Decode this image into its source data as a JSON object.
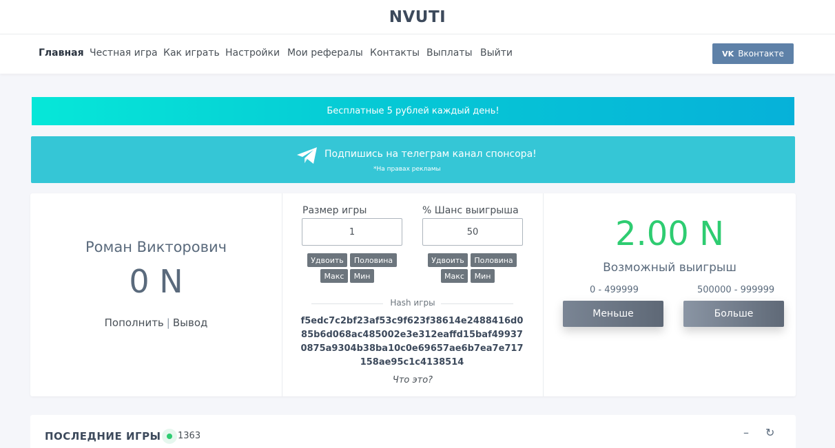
{
  "header": {
    "brand": "NVUTI"
  },
  "nav": {
    "items": [
      "Главная",
      "Честная игра",
      "Как играть",
      "Настройки",
      "Мои рефералы",
      "Контакты",
      "Выплаты",
      "Выйти"
    ],
    "vk_label": "Вконтакте"
  },
  "banners": {
    "free": "Бесплатные 5 рублей каждый день!",
    "telegram_title": "Подпишись на телеграм канал спонсора!",
    "telegram_sub": "*На правах рекламы"
  },
  "user": {
    "name": "Роман Викторович",
    "balance": "0 N",
    "deposit": "Пополнить",
    "separator": "|",
    "withdraw": "Вывод"
  },
  "bet": {
    "size_label": "Размер игры",
    "size_value": "1",
    "chance_label": "% Шанс выигрыша",
    "chance_value": "50",
    "double": "Удвоить",
    "half": "Половина",
    "max": "Макс",
    "min": "Мин"
  },
  "hash": {
    "label": "Hash игры",
    "value": "f5edc7c2bf23af53c9f623f38614e2488416d085b6d068ac485002e3e312eaffd15baf499370875a9304b38ba10c0e69657ae6b7ea7e717158ae95c1c4138514",
    "help": "Что это?"
  },
  "result": {
    "amount": "2.00 N",
    "label": "Возможный выигрыш",
    "range_low": "0 - 499999",
    "range_high": "500000 - 999999",
    "less": "Меньше",
    "more": "Больше"
  },
  "recent": {
    "title": "ПОСЛЕДНИЕ ИГРЫ",
    "online_count": "1363",
    "minimize_symbol": "–",
    "refresh_symbol": "↻"
  },
  "colors": {
    "accent_green": "#2ecc71",
    "vk_blue": "#5e81a8",
    "telegram_banner": "#35c6d6"
  }
}
